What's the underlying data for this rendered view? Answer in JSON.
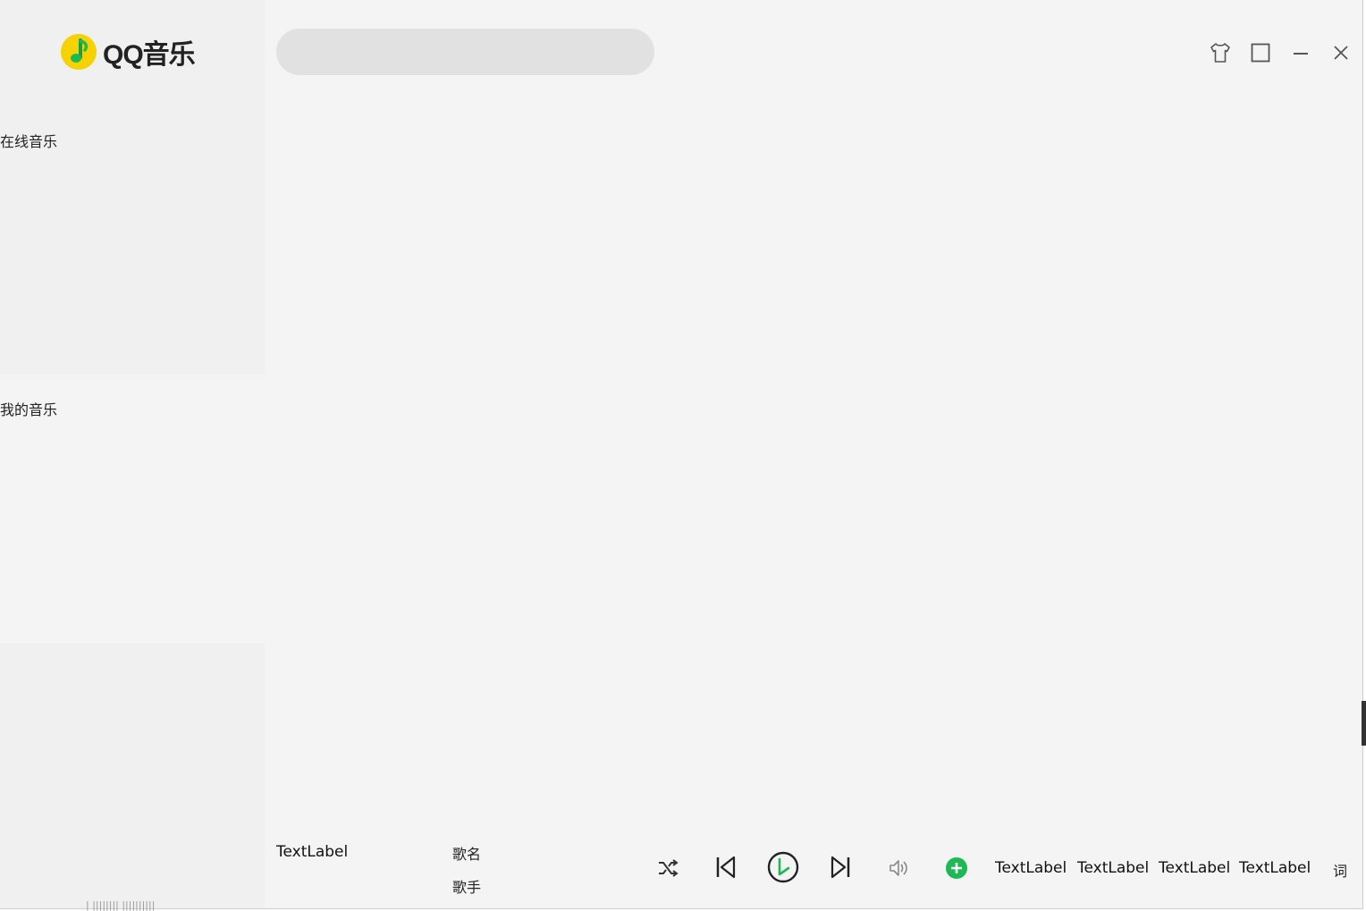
{
  "app": {
    "logo_text": "QQ音乐",
    "logo_colors": {
      "disc": "#f5d200",
      "note": "#1db954"
    }
  },
  "sidebar": {
    "sections": [
      {
        "label": "在线音乐"
      },
      {
        "label": "我的音乐"
      }
    ],
    "faint_text": "|  ||||||||  ||||||||||"
  },
  "search": {
    "placeholder": "",
    "value": ""
  },
  "window_controls": [
    "skin-icon",
    "maximize-icon",
    "minimize-icon",
    "close-icon"
  ],
  "player": {
    "cover_label": "TextLabel",
    "song_name": "歌名",
    "artist": "歌手",
    "controls": [
      "shuffle-icon",
      "previous-icon",
      "play-icon",
      "next-icon",
      "volume-icon",
      "add-icon"
    ],
    "labels": [
      "TextLabel",
      "TextLabel",
      "TextLabel",
      "TextLabel"
    ],
    "lyrics_button": "词",
    "accent": "#1db954"
  }
}
